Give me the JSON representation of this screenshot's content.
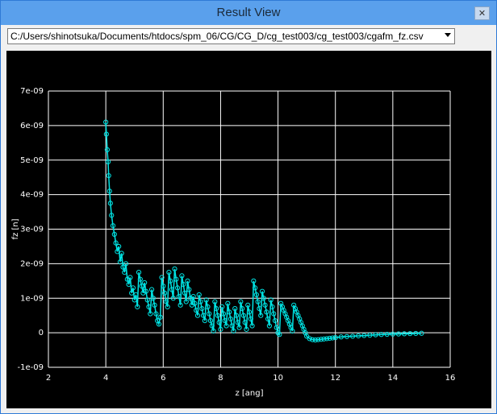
{
  "window": {
    "title": "Result View",
    "close_icon": "close-icon"
  },
  "toolbar": {
    "file_path": "C:/Users/shinotsuka/Documents/htdocs/spm_06/CG/CG_D/cg_test003/cg_test003/cgafm_fz.csv"
  },
  "colors": {
    "series": "#00e5e5",
    "grid": "#ffffff",
    "background": "#000000"
  },
  "chart_data": {
    "type": "scatter",
    "xlabel": "z [ang]",
    "ylabel": "fz [n]",
    "xlim": [
      2,
      16
    ],
    "ylim": [
      -1e-09,
      7e-09
    ],
    "x_ticks": [
      2,
      4,
      6,
      8,
      10,
      12,
      14,
      16
    ],
    "y_ticks": [
      -1e-09,
      0,
      1e-09,
      2e-09,
      3e-09,
      4e-09,
      5e-09,
      6e-09,
      7e-09
    ],
    "x_tick_labels": [
      "2",
      "4",
      "6",
      "8",
      "10",
      "12",
      "14",
      "16"
    ],
    "y_tick_labels": [
      "-1e-09",
      "0",
      "1e-09",
      "2e-09",
      "3e-09",
      "4e-09",
      "5e-09",
      "6e-09",
      "7e-09"
    ],
    "grid": true,
    "marker": "circle-open",
    "series": [
      {
        "x": [
          4.0,
          4.02,
          4.05,
          4.08,
          4.1,
          4.13,
          4.16,
          4.2,
          4.25,
          4.3,
          4.35,
          4.4,
          4.45,
          4.5,
          4.55,
          4.6,
          4.65,
          4.7,
          4.75,
          4.8,
          4.85,
          4.9,
          4.95,
          5.0,
          5.05,
          5.1,
          5.15,
          5.2,
          5.25,
          5.3,
          5.35,
          5.4,
          5.45,
          5.5,
          5.55,
          5.6,
          5.65,
          5.7,
          5.75,
          5.8,
          5.85,
          5.9,
          5.95,
          6.0,
          6.05,
          6.1,
          6.15,
          6.2,
          6.25,
          6.3,
          6.35,
          6.4,
          6.45,
          6.5,
          6.55,
          6.6,
          6.65,
          6.7,
          6.75,
          6.8,
          6.85,
          6.9,
          6.95,
          7.0,
          7.05,
          7.1,
          7.15,
          7.2,
          7.25,
          7.3,
          7.35,
          7.4,
          7.45,
          7.5,
          7.55,
          7.6,
          7.65,
          7.7,
          7.75,
          7.8,
          7.85,
          7.9,
          7.95,
          8.0,
          8.05,
          8.1,
          8.15,
          8.2,
          8.25,
          8.3,
          8.35,
          8.4,
          8.45,
          8.5,
          8.55,
          8.6,
          8.65,
          8.7,
          8.75,
          8.8,
          8.85,
          8.9,
          8.95,
          9.0,
          9.05,
          9.1,
          9.15,
          9.2,
          9.25,
          9.3,
          9.35,
          9.4,
          9.45,
          9.5,
          9.55,
          9.6,
          9.65,
          9.7,
          9.75,
          9.8,
          9.85,
          9.9,
          9.95,
          10.0,
          10.05,
          10.1,
          10.15,
          10.2,
          10.25,
          10.3,
          10.35,
          10.4,
          10.45,
          10.5,
          10.55,
          10.6,
          10.65,
          10.7,
          10.75,
          10.8,
          10.85,
          10.9,
          10.95,
          11.0,
          11.1,
          11.2,
          11.3,
          11.4,
          11.5,
          11.6,
          11.7,
          11.8,
          11.9,
          12.0,
          12.2,
          12.4,
          12.6,
          12.8,
          13.0,
          13.2,
          13.4,
          13.6,
          13.8,
          14.0,
          14.2,
          14.4,
          14.6,
          14.8,
          15.0
        ],
        "y": [
          6.1e-09,
          5.75e-09,
          5.3e-09,
          4.95e-09,
          4.55e-09,
          4.1e-09,
          3.75e-09,
          3.4e-09,
          3.1e-09,
          2.85e-09,
          2.6e-09,
          2.35e-09,
          2.5e-09,
          2.05e-09,
          2.3e-09,
          1.9e-09,
          1.75e-09,
          2e-09,
          1.55e-09,
          1.4e-09,
          1.6e-09,
          1.15e-09,
          1.3e-09,
          9.5e-10,
          1.1e-09,
          7.5e-10,
          1.75e-09,
          1.55e-09,
          1.35e-09,
          1.15e-09,
          1.45e-09,
          1.2e-09,
          9.5e-10,
          7.5e-10,
          5.5e-10,
          1.25e-09,
          1e-09,
          8e-10,
          5.5e-10,
          3.5e-10,
          2.5e-10,
          4.5e-10,
          1.6e-09,
          1.35e-09,
          1.15e-09,
          9e-10,
          7.5e-10,
          1.75e-09,
          1.5e-09,
          1.25e-09,
          1e-09,
          1.85e-09,
          1.55e-09,
          1.3e-09,
          1.05e-09,
          8e-10,
          1.65e-09,
          1.4e-09,
          1.15e-09,
          9e-10,
          1.5e-09,
          1.25e-09,
          1e-09,
          8e-10,
          1.05e-09,
          8.5e-10,
          6.5e-10,
          5e-10,
          1.1e-09,
          9e-10,
          7e-10,
          5e-10,
          3.5e-10,
          9.5e-10,
          7.5e-10,
          5.5e-10,
          3.5e-10,
          2e-10,
          5e-11,
          9e-10,
          7e-10,
          5e-10,
          3e-10,
          1e-10,
          7.5e-10,
          5.5e-10,
          3.5e-10,
          2e-10,
          8.5e-10,
          6e-10,
          4e-10,
          2e-10,
          5e-11,
          7e-10,
          5e-10,
          3e-10,
          1.5e-10,
          9e-10,
          7e-10,
          5e-10,
          3e-10,
          1e-10,
          8e-10,
          6e-10,
          4e-10,
          2e-10,
          1.5e-09,
          1.3e-09,
          1.1e-09,
          9e-10,
          7e-10,
          5e-10,
          1.2e-09,
          1e-09,
          8e-10,
          6e-10,
          4e-10,
          2e-10,
          9.5e-10,
          7.5e-10,
          5.5e-10,
          3.5e-10,
          1.5e-10,
          0.0,
          -5e-11,
          8.5e-10,
          7.5e-10,
          6.5e-10,
          5.5e-10,
          4.5e-10,
          3.5e-10,
          2.5e-10,
          1.5e-10,
          5e-11,
          8e-10,
          7e-10,
          6e-10,
          5e-10,
          4e-10,
          3e-10,
          2e-10,
          1e-10,
          0.0,
          -1e-10,
          -1.7e-10,
          -2e-10,
          -2.1e-10,
          -2e-10,
          -1.9e-10,
          -1.8e-10,
          -1.7e-10,
          -1.6e-10,
          -1.5e-10,
          -1.4e-10,
          -1.2e-10,
          -1.1e-10,
          -1e-10,
          -9e-11,
          -8e-11,
          -7e-11,
          -6e-11,
          -5e-11,
          -4.5e-11,
          -4e-11,
          -3.5e-11,
          -3e-11,
          -2.5e-11,
          -2e-11,
          -1.5e-11
        ]
      }
    ]
  }
}
